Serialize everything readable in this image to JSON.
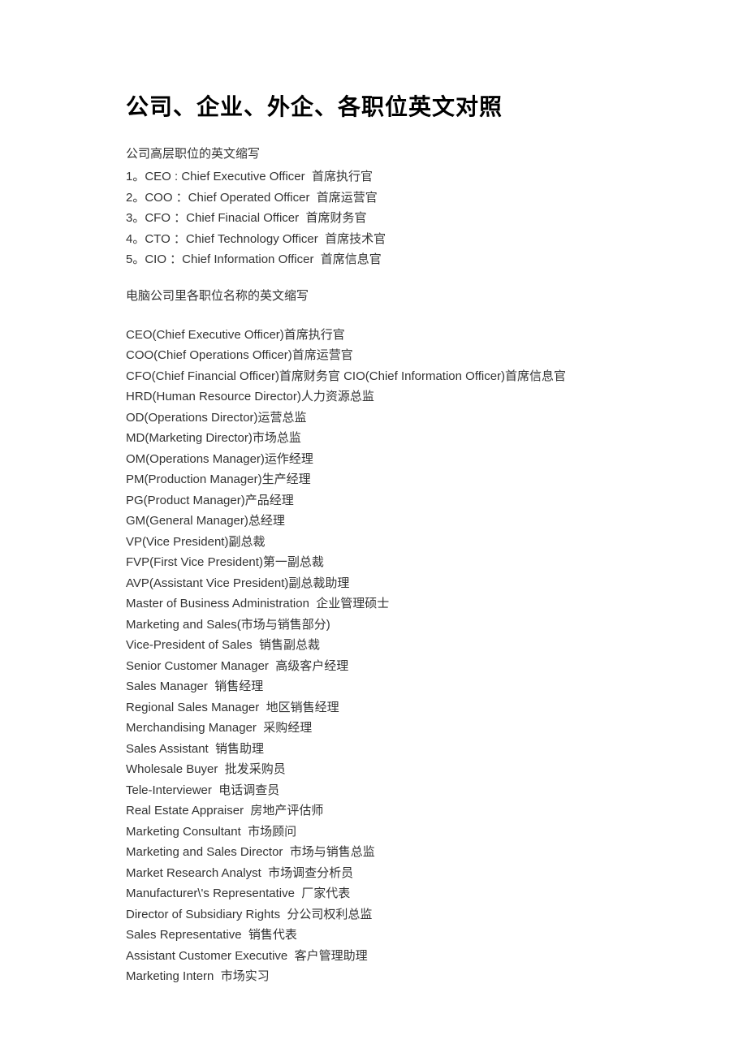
{
  "title": "公司、企业、外企、各职位英文对照",
  "section1": {
    "heading": "公司高层职位的英文缩写",
    "items": [
      "1。CEO : Chief Executive Officer  首席执行官",
      "2。COO ：Chief Operated Officer  首席运营官",
      "3。CFO ：Chief Finacial Officer  首席财务官",
      "4。CTO ：Chief Technology Officer  首席技术官",
      "5。CIO ：Chief Information Officer  首席信息官"
    ]
  },
  "section2": {
    "heading": "电脑公司里各职位名称的英文缩写",
    "items": [
      "CEO(Chief Executive Officer)首席执行官",
      "COO(Chief Operations Officer)首席运营官",
      "CFO(Chief Financial Officer)首席财务官 CIO(Chief Information Officer)首席信息官",
      "HRD(Human Resource Director)人力资源总监",
      "OD(Operations Director)运营总监",
      "MD(Marketing Director)市场总监",
      "OM(Operations Manager)运作经理",
      "PM(Production Manager)生产经理",
      "PG(Product Manager)产品经理",
      "GM(General Manager)总经理",
      "VP(Vice President)副总裁",
      "FVP(First Vice President)第一副总裁",
      "AVP(Assistant Vice President)副总裁助理",
      "Master of Business Administration  企业管理硕士",
      "Marketing and Sales(市场与销售部分)",
      "Vice-President of Sales  销售副总裁",
      "Senior Customer Manager  高级客户经理",
      "Sales Manager  销售经理",
      "Regional Sales Manager  地区销售经理",
      "Merchandising Manager  采购经理",
      "Sales Assistant  销售助理",
      "Wholesale Buyer  批发采购员",
      "Tele-Interviewer  电话调查员",
      "Real Estate Appraiser  房地产评估师",
      "Marketing Consultant  市场顾问",
      "Marketing and Sales Director  市场与销售总监",
      "Market Research Analyst  市场调查分析员",
      "Manufacturer\\'s Representative  厂家代表",
      "Director of Subsidiary Rights  分公司权利总监",
      "Sales Representative  销售代表",
      "Assistant Customer Executive  客户管理助理",
      "Marketing Intern  市场实习"
    ]
  }
}
